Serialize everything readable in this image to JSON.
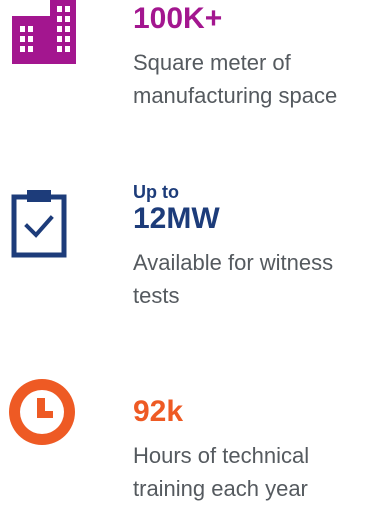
{
  "stats": [
    {
      "icon": "building-icon",
      "prefix": "",
      "value": "100K+",
      "description": "Square meter of manufacturing space",
      "color": "#a3168f"
    },
    {
      "icon": "clipboard-check-icon",
      "prefix": "Up to",
      "value": "12MW",
      "description": "Available for witness tests",
      "color": "#1d3c7a"
    },
    {
      "icon": "clock-icon",
      "prefix": "",
      "value": "92k",
      "description": "Hours of technical training each year",
      "color": "#ee5a24"
    }
  ]
}
